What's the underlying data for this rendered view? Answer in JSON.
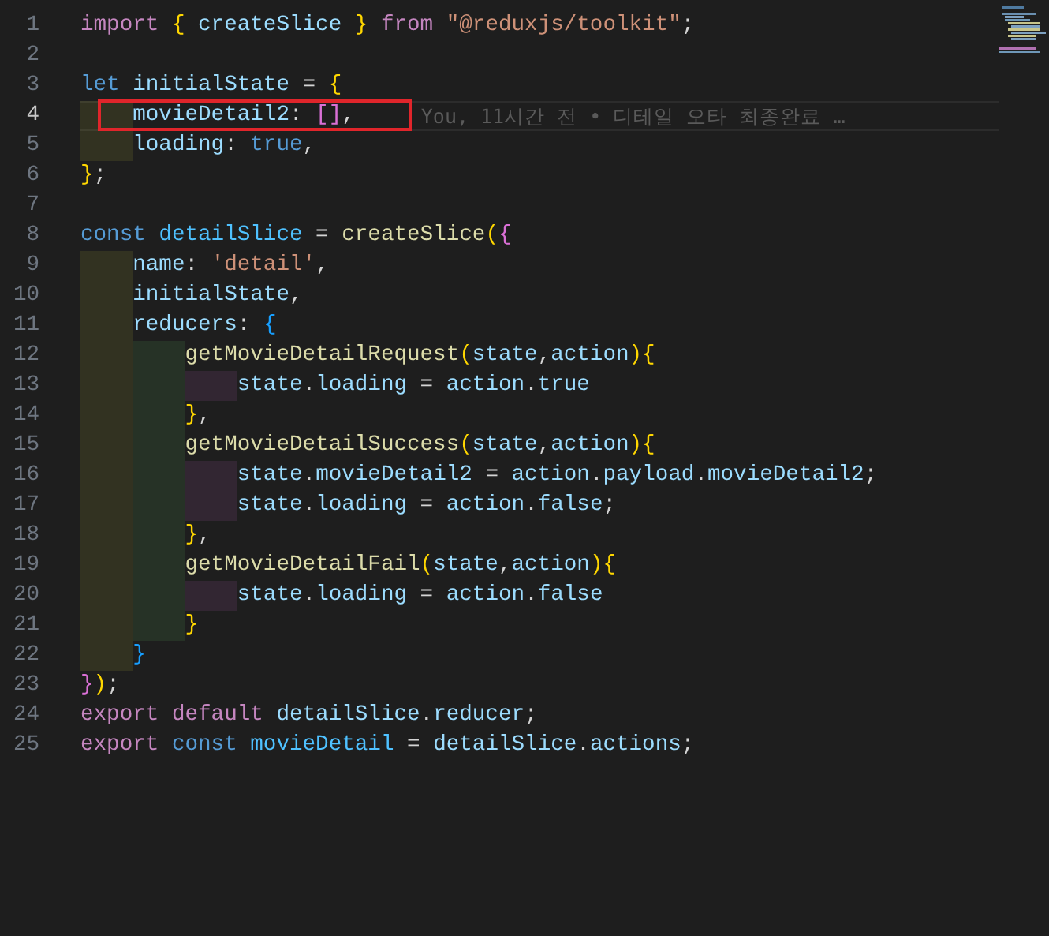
{
  "lines": [
    {
      "number": "1",
      "tokens": [
        {
          "t": "import ",
          "color": "#c586c0"
        },
        {
          "t": "{",
          "color": "#ffd700"
        },
        {
          "t": " createSlice ",
          "color": "#9cdcfe"
        },
        {
          "t": "}",
          "color": "#ffd700"
        },
        {
          "t": " from ",
          "color": "#c586c0"
        },
        {
          "t": "\"@reduxjs/toolkit\"",
          "color": "#ce9178"
        },
        {
          "t": ";",
          "color": "#d4d4d4"
        }
      ]
    },
    {
      "number": "2"
    },
    {
      "number": "3",
      "tokens": [
        {
          "t": "let ",
          "color": "#569cd6"
        },
        {
          "t": "initialState",
          "color": "#9cdcfe"
        },
        {
          "t": " = ",
          "color": "#d4d4d4"
        },
        {
          "t": "{",
          "color": "#ffd700"
        }
      ]
    },
    {
      "number": "4",
      "current": true,
      "boxed": true,
      "blame": "You, 11시간 전 • 디테일 오타 최종완료 …",
      "tokens": [
        {
          "t": "    movieDetail2",
          "color": "#9cdcfe"
        },
        {
          "t": ": ",
          "color": "#d4d4d4"
        },
        {
          "t": "[]",
          "color": "#da70d6"
        },
        {
          "t": ",",
          "color": "#d4d4d4"
        }
      ]
    },
    {
      "number": "5",
      "tokens": [
        {
          "t": "    loading",
          "color": "#9cdcfe"
        },
        {
          "t": ": ",
          "color": "#d4d4d4"
        },
        {
          "t": "true",
          "color": "#569cd6"
        },
        {
          "t": ",",
          "color": "#d4d4d4"
        }
      ]
    },
    {
      "number": "6",
      "tokens": [
        {
          "t": "}",
          "color": "#ffd700"
        },
        {
          "t": ";",
          "color": "#d4d4d4"
        }
      ]
    },
    {
      "number": "7"
    },
    {
      "number": "8",
      "tokens": [
        {
          "t": "const ",
          "color": "#569cd6"
        },
        {
          "t": "detailSlice",
          "color": "#4fc1ff"
        },
        {
          "t": " = ",
          "color": "#d4d4d4"
        },
        {
          "t": "createSlice",
          "color": "#dcdcaa"
        },
        {
          "t": "(",
          "color": "#ffd700"
        },
        {
          "t": "{",
          "color": "#da70d6"
        }
      ]
    },
    {
      "number": "9",
      "tokens": [
        {
          "t": "    name",
          "color": "#9cdcfe"
        },
        {
          "t": ": ",
          "color": "#d4d4d4"
        },
        {
          "t": "'detail'",
          "color": "#ce9178"
        },
        {
          "t": ",",
          "color": "#d4d4d4"
        }
      ]
    },
    {
      "number": "10",
      "tokens": [
        {
          "t": "    initialState",
          "color": "#9cdcfe"
        },
        {
          "t": ",",
          "color": "#d4d4d4"
        }
      ]
    },
    {
      "number": "11",
      "tokens": [
        {
          "t": "    reducers",
          "color": "#9cdcfe"
        },
        {
          "t": ": ",
          "color": "#d4d4d4"
        },
        {
          "t": "{",
          "color": "#179fff"
        }
      ]
    },
    {
      "number": "12",
      "tokens": [
        {
          "t": "        getMovieDetailRequest",
          "color": "#dcdcaa"
        },
        {
          "t": "(",
          "color": "#ffd700"
        },
        {
          "t": "state",
          "color": "#9cdcfe"
        },
        {
          "t": ",",
          "color": "#d4d4d4"
        },
        {
          "t": "action",
          "color": "#9cdcfe"
        },
        {
          "t": "){",
          "color": "#ffd700"
        }
      ]
    },
    {
      "number": "13",
      "tokens": [
        {
          "t": "            state",
          "color": "#9cdcfe"
        },
        {
          "t": ".",
          "color": "#d4d4d4"
        },
        {
          "t": "loading",
          "color": "#9cdcfe"
        },
        {
          "t": " = ",
          "color": "#d4d4d4"
        },
        {
          "t": "action",
          "color": "#9cdcfe"
        },
        {
          "t": ".",
          "color": "#d4d4d4"
        },
        {
          "t": "true",
          "color": "#9cdcfe"
        }
      ]
    },
    {
      "number": "14",
      "tokens": [
        {
          "t": "        }",
          "color": "#ffd700"
        },
        {
          "t": ",",
          "color": "#d4d4d4"
        }
      ]
    },
    {
      "number": "15",
      "tokens": [
        {
          "t": "        getMovieDetailSuccess",
          "color": "#dcdcaa"
        },
        {
          "t": "(",
          "color": "#ffd700"
        },
        {
          "t": "state",
          "color": "#9cdcfe"
        },
        {
          "t": ",",
          "color": "#d4d4d4"
        },
        {
          "t": "action",
          "color": "#9cdcfe"
        },
        {
          "t": "){",
          "color": "#ffd700"
        }
      ]
    },
    {
      "number": "16",
      "tokens": [
        {
          "t": "            state",
          "color": "#9cdcfe"
        },
        {
          "t": ".",
          "color": "#d4d4d4"
        },
        {
          "t": "movieDetail2",
          "color": "#9cdcfe"
        },
        {
          "t": " = ",
          "color": "#d4d4d4"
        },
        {
          "t": "action",
          "color": "#9cdcfe"
        },
        {
          "t": ".",
          "color": "#d4d4d4"
        },
        {
          "t": "payload",
          "color": "#9cdcfe"
        },
        {
          "t": ".",
          "color": "#d4d4d4"
        },
        {
          "t": "movieDetail2",
          "color": "#9cdcfe"
        },
        {
          "t": ";",
          "color": "#d4d4d4"
        }
      ]
    },
    {
      "number": "17",
      "tokens": [
        {
          "t": "            state",
          "color": "#9cdcfe"
        },
        {
          "t": ".",
          "color": "#d4d4d4"
        },
        {
          "t": "loading",
          "color": "#9cdcfe"
        },
        {
          "t": " = ",
          "color": "#d4d4d4"
        },
        {
          "t": "action",
          "color": "#9cdcfe"
        },
        {
          "t": ".",
          "color": "#d4d4d4"
        },
        {
          "t": "false",
          "color": "#9cdcfe"
        },
        {
          "t": ";",
          "color": "#d4d4d4"
        }
      ]
    },
    {
      "number": "18",
      "tokens": [
        {
          "t": "        }",
          "color": "#ffd700"
        },
        {
          "t": ",",
          "color": "#d4d4d4"
        }
      ]
    },
    {
      "number": "19",
      "tokens": [
        {
          "t": "        getMovieDetailFail",
          "color": "#dcdcaa"
        },
        {
          "t": "(",
          "color": "#ffd700"
        },
        {
          "t": "state",
          "color": "#9cdcfe"
        },
        {
          "t": ",",
          "color": "#d4d4d4"
        },
        {
          "t": "action",
          "color": "#9cdcfe"
        },
        {
          "t": "){",
          "color": "#ffd700"
        }
      ]
    },
    {
      "number": "20",
      "tokens": [
        {
          "t": "            state",
          "color": "#9cdcfe"
        },
        {
          "t": ".",
          "color": "#d4d4d4"
        },
        {
          "t": "loading",
          "color": "#9cdcfe"
        },
        {
          "t": " = ",
          "color": "#d4d4d4"
        },
        {
          "t": "action",
          "color": "#9cdcfe"
        },
        {
          "t": ".",
          "color": "#d4d4d4"
        },
        {
          "t": "false",
          "color": "#9cdcfe"
        }
      ]
    },
    {
      "number": "21",
      "tokens": [
        {
          "t": "        }",
          "color": "#ffd700"
        }
      ]
    },
    {
      "number": "22",
      "tokens": [
        {
          "t": "    }",
          "color": "#179fff"
        }
      ]
    },
    {
      "number": "23",
      "tokens": [
        {
          "t": "}",
          "color": "#da70d6"
        },
        {
          "t": ")",
          "color": "#ffd700"
        },
        {
          "t": ";",
          "color": "#d4d4d4"
        }
      ]
    },
    {
      "number": "24",
      "tokens": [
        {
          "t": "export default ",
          "color": "#c586c0"
        },
        {
          "t": "detailSlice",
          "color": "#9cdcfe"
        },
        {
          "t": ".",
          "color": "#d4d4d4"
        },
        {
          "t": "reducer",
          "color": "#9cdcfe"
        },
        {
          "t": ";",
          "color": "#d4d4d4"
        }
      ]
    },
    {
      "number": "25",
      "tokens": [
        {
          "t": "export ",
          "color": "#c586c0"
        },
        {
          "t": "const ",
          "color": "#569cd6"
        },
        {
          "t": "movieDetail",
          "color": "#4fc1ff"
        },
        {
          "t": " = ",
          "color": "#d4d4d4"
        },
        {
          "t": "detailSlice",
          "color": "#9cdcfe"
        },
        {
          "t": ".",
          "color": "#d4d4d4"
        },
        {
          "t": "actions",
          "color": "#9cdcfe"
        },
        {
          "t": ";",
          "color": "#d4d4d4"
        }
      ]
    }
  ]
}
